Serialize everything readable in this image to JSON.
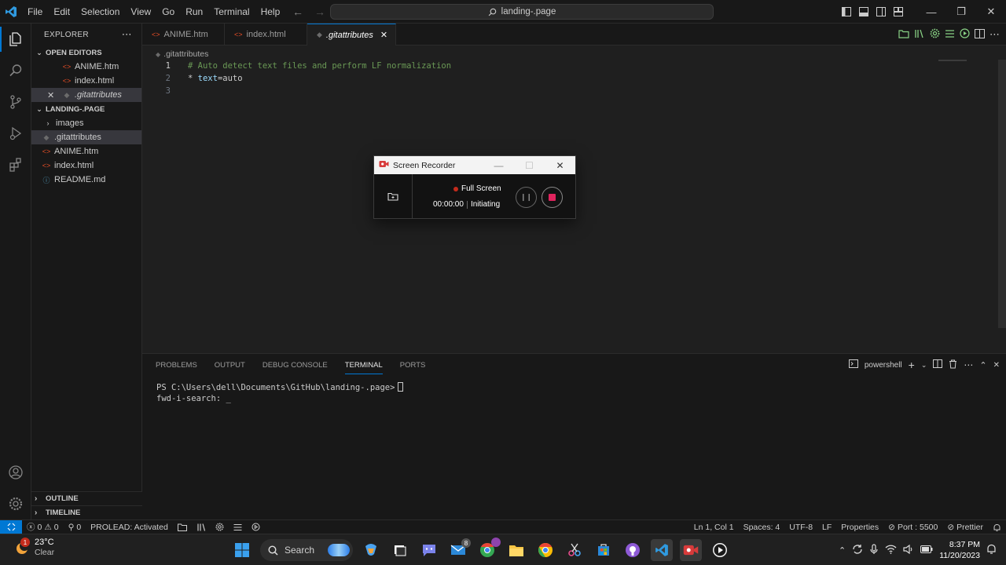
{
  "titlebar": {
    "menu": [
      "File",
      "Edit",
      "Selection",
      "View",
      "Go",
      "Run",
      "Terminal",
      "Help"
    ],
    "search_text": "landing-.page"
  },
  "explorer": {
    "title": "EXPLORER",
    "open_editors_label": "OPEN EDITORS",
    "open_editors": [
      "ANIME.htm",
      "index.html",
      ".gitattributes"
    ],
    "folder_label": "LANDING-.PAGE",
    "folder_items": [
      "images",
      ".gitattributes",
      "ANIME.htm",
      "index.html",
      "README.md"
    ],
    "outline_label": "OUTLINE",
    "timeline_label": "TIMELINE"
  },
  "tabs": [
    "ANIME.htm",
    "index.html",
    ".gitattributes"
  ],
  "breadcrumb": ".gitattributes",
  "editor": {
    "line_numbers": [
      "1",
      "2",
      "3"
    ],
    "line1": "# Auto detect text files and perform LF normalization",
    "line2_star": "* ",
    "line2_key": "text",
    "line2_eq": "=",
    "line2_val": "auto"
  },
  "panel": {
    "tabs": [
      "PROBLEMS",
      "OUTPUT",
      "DEBUG CONSOLE",
      "TERMINAL",
      "PORTS"
    ],
    "active_tab": "TERMINAL",
    "shell_label": "powershell",
    "terminal_line1": "PS C:\\Users\\dell\\Documents\\GitHub\\landing-.page>",
    "terminal_line2": "fwd-i-search: _"
  },
  "statusbar": {
    "errors": "0",
    "warnings": "0",
    "ports_fwd": "0",
    "prolead": "PROLEAD: Activated",
    "position": "Ln 1, Col 1",
    "spaces": "Spaces: 4",
    "encoding": "UTF-8",
    "eol": "LF",
    "language": "Properties",
    "port": "Port : 5500",
    "prettier": "Prettier"
  },
  "recorder": {
    "title": "Screen Recorder",
    "mode": "Full Screen",
    "time": "00:00:00",
    "status": "Initiating"
  },
  "taskbar": {
    "temperature": "23°C",
    "condition": "Clear",
    "weather_badge": "1",
    "search_label": "Search",
    "time": "8:37 PM",
    "date": "11/20/2023",
    "mail_badge": "8"
  },
  "colors": {
    "accent": "#0078d4",
    "html_icon": "#e44d26",
    "comment": "#6a9955",
    "record_stop": "#e0245e"
  }
}
